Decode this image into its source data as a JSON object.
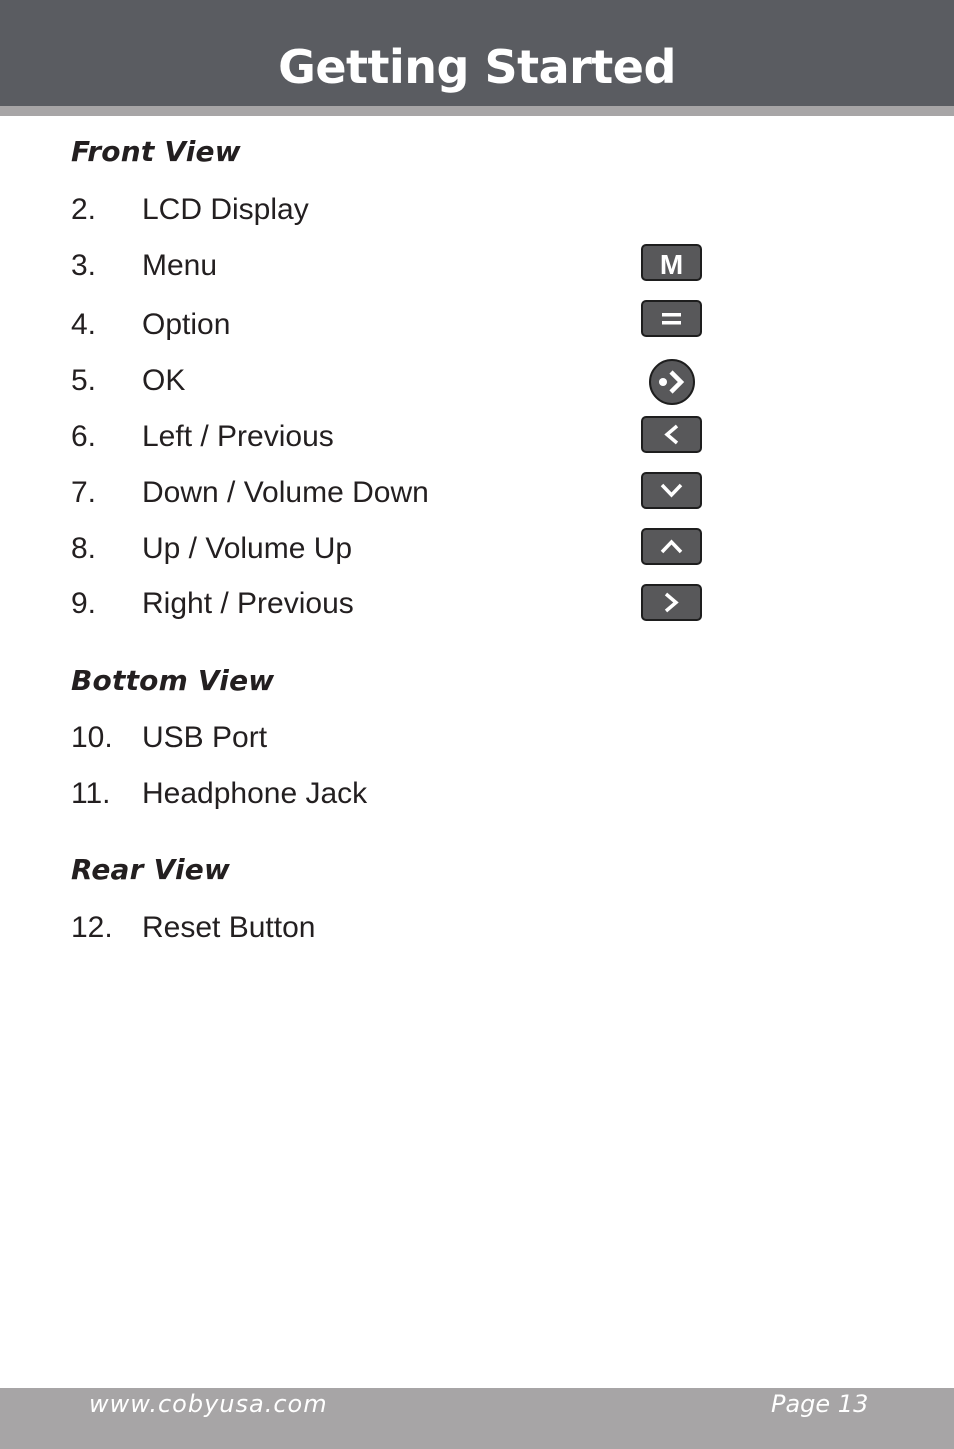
{
  "header": {
    "title": "Getting Started"
  },
  "sections": [
    {
      "heading": "Front View",
      "items": [
        {
          "number": "2.",
          "label": "LCD Display",
          "icon": null
        },
        {
          "number": "3.",
          "label": "Menu",
          "icon": "menu-m-icon",
          "glyph": "M"
        },
        {
          "number": "4.",
          "label": "Option",
          "icon": "option-equals-icon"
        },
        {
          "number": "5.",
          "label": "OK",
          "icon": "ok-circle-arrow-icon"
        },
        {
          "number": "6.",
          "label": "Left / Previous",
          "icon": "chevron-left-icon"
        },
        {
          "number": "7.",
          "label": "Down / Volume Down",
          "icon": "chevron-down-icon"
        },
        {
          "number": "8.",
          "label": "Up / Volume Up",
          "icon": "chevron-up-icon"
        },
        {
          "number": "9.",
          "label": "Right / Previous",
          "icon": "chevron-right-icon"
        }
      ]
    },
    {
      "heading": "Bottom View",
      "items": [
        {
          "number": "10.",
          "label": "USB Port"
        },
        {
          "number": "11.",
          "label": "Headphone Jack"
        }
      ]
    },
    {
      "heading": "Rear View",
      "items": [
        {
          "number": "12.",
          "label": "Reset Button"
        }
      ]
    }
  ],
  "footer": {
    "url": "www.cobyusa.com",
    "page": "Page 13"
  },
  "colors": {
    "header_bg": "#5a5c61",
    "stripe": "#a7a5a6",
    "button_fill": "#58585a",
    "text": "#231f20"
  }
}
